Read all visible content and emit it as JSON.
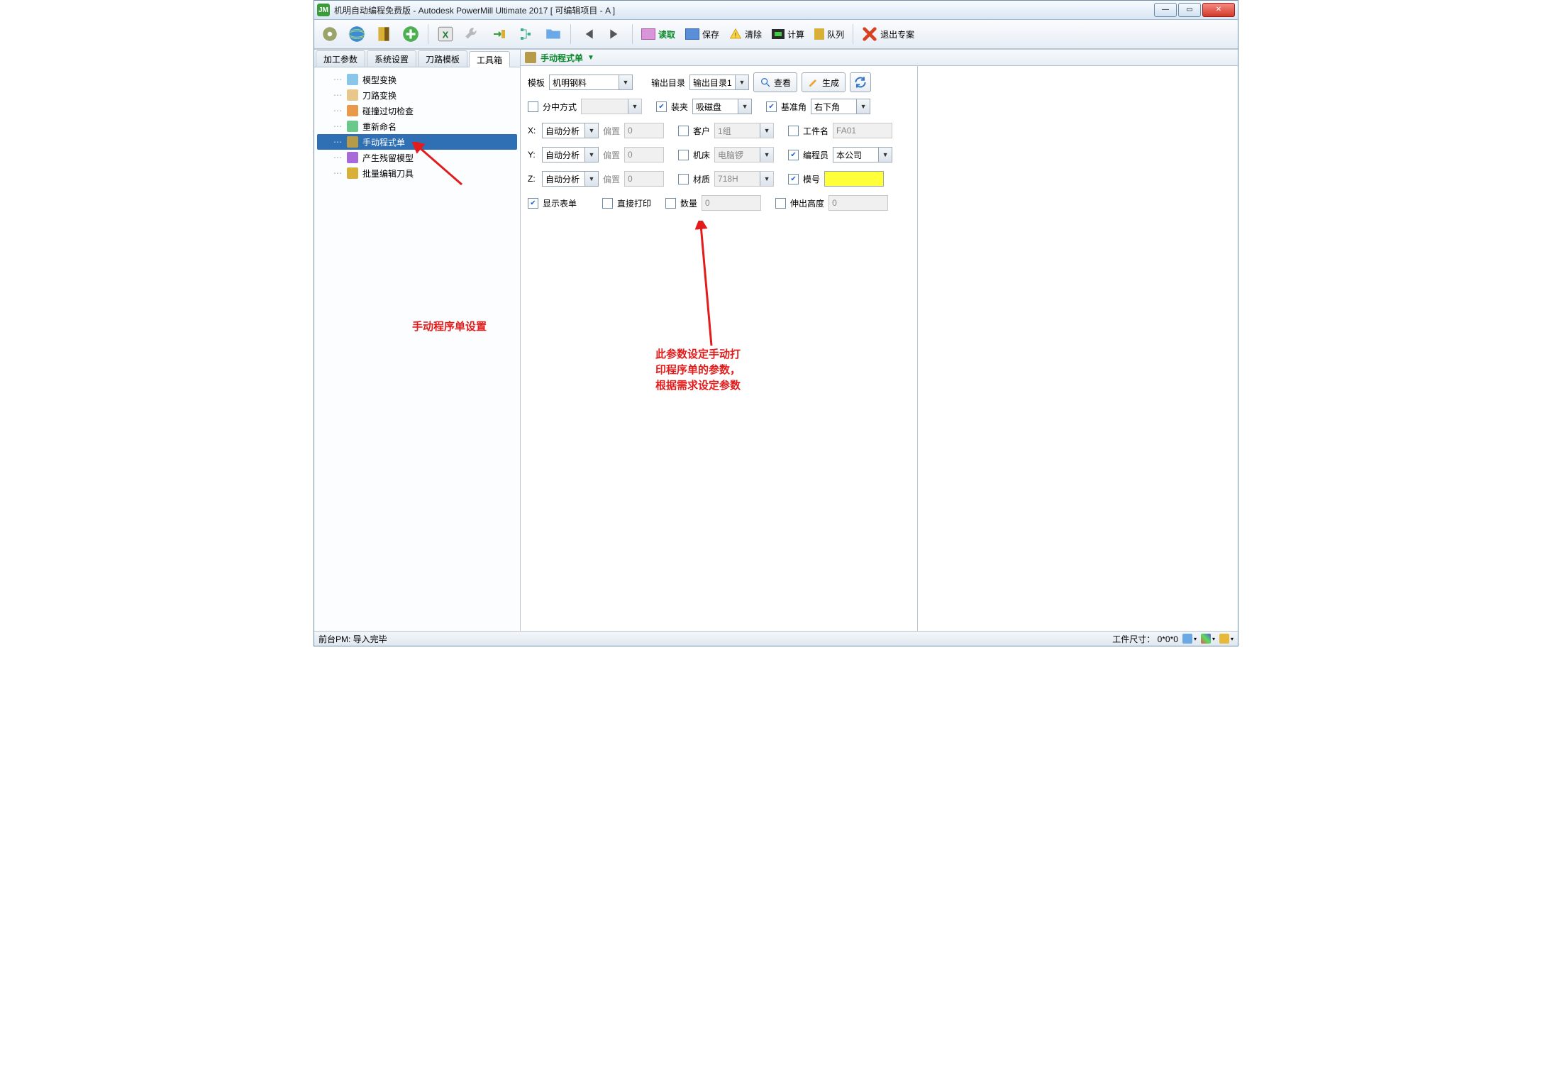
{
  "window": {
    "title": "机明自动编程免费版 - Autodesk PowerMill Ultimate 2017    [ 可编辑项目 - A ]"
  },
  "main_toolbar": {
    "read": "读取",
    "save": "保存",
    "clear": "清除",
    "calc": "计算",
    "queue": "队列",
    "exit": "退出专案"
  },
  "tabs": {
    "t1": "加工参数",
    "t2": "系统设置",
    "t3": "刀路模板",
    "t4": "工具箱"
  },
  "tree": {
    "i1": "模型变换",
    "i2": "刀路变换",
    "i3": "碰撞过切检查",
    "i4": "重新命名",
    "i5": "手动程式单",
    "i6": "产生残留模型",
    "i7": "批量编辑刀具"
  },
  "subtoolbar": {
    "title": "手动程式单"
  },
  "form": {
    "template_lbl": "模板",
    "template_val": "机明钢料",
    "outdir_lbl": "输出目录",
    "outdir_val": "输出目录1",
    "view_btn": "查看",
    "gen_btn": "生成",
    "center_lbl": "分中方式",
    "center_val": "",
    "clamp_lbl": "装夹",
    "clamp_val": "吸磁盘",
    "datum_lbl": "基准角",
    "datum_val": "右下角",
    "x_lbl": "X:",
    "x_mode": "自动分析",
    "x_off_lbl": "偏置",
    "x_off_val": "0",
    "y_lbl": "Y:",
    "y_mode": "自动分析",
    "y_off_lbl": "偏置",
    "y_off_val": "0",
    "z_lbl": "Z:",
    "z_mode": "自动分析",
    "z_off_lbl": "偏置",
    "z_off_val": "0",
    "cust_lbl": "客户",
    "cust_val": "1组",
    "mach_lbl": "机床",
    "mach_val": "电脑锣",
    "mat_lbl": "材质",
    "mat_val": "718H",
    "part_lbl": "工件名",
    "part_val": "FA01",
    "prog_lbl": "编程员",
    "prog_val": "本公司",
    "mold_lbl": "模号",
    "mold_val": "",
    "show_lbl": "显示表单",
    "print_lbl": "直接打印",
    "qty_lbl": "数量",
    "qty_val": "0",
    "ext_lbl": "伸出高度",
    "ext_val": "0"
  },
  "annotations": {
    "left": "手动程序单设置",
    "right_l1": "此参数设定手动打",
    "right_l2": "印程序单的参数，",
    "right_l3": "根据需求设定参数"
  },
  "status": {
    "left": "前台PM: 导入完毕",
    "right": "工件尺寸：  0*0*0"
  }
}
